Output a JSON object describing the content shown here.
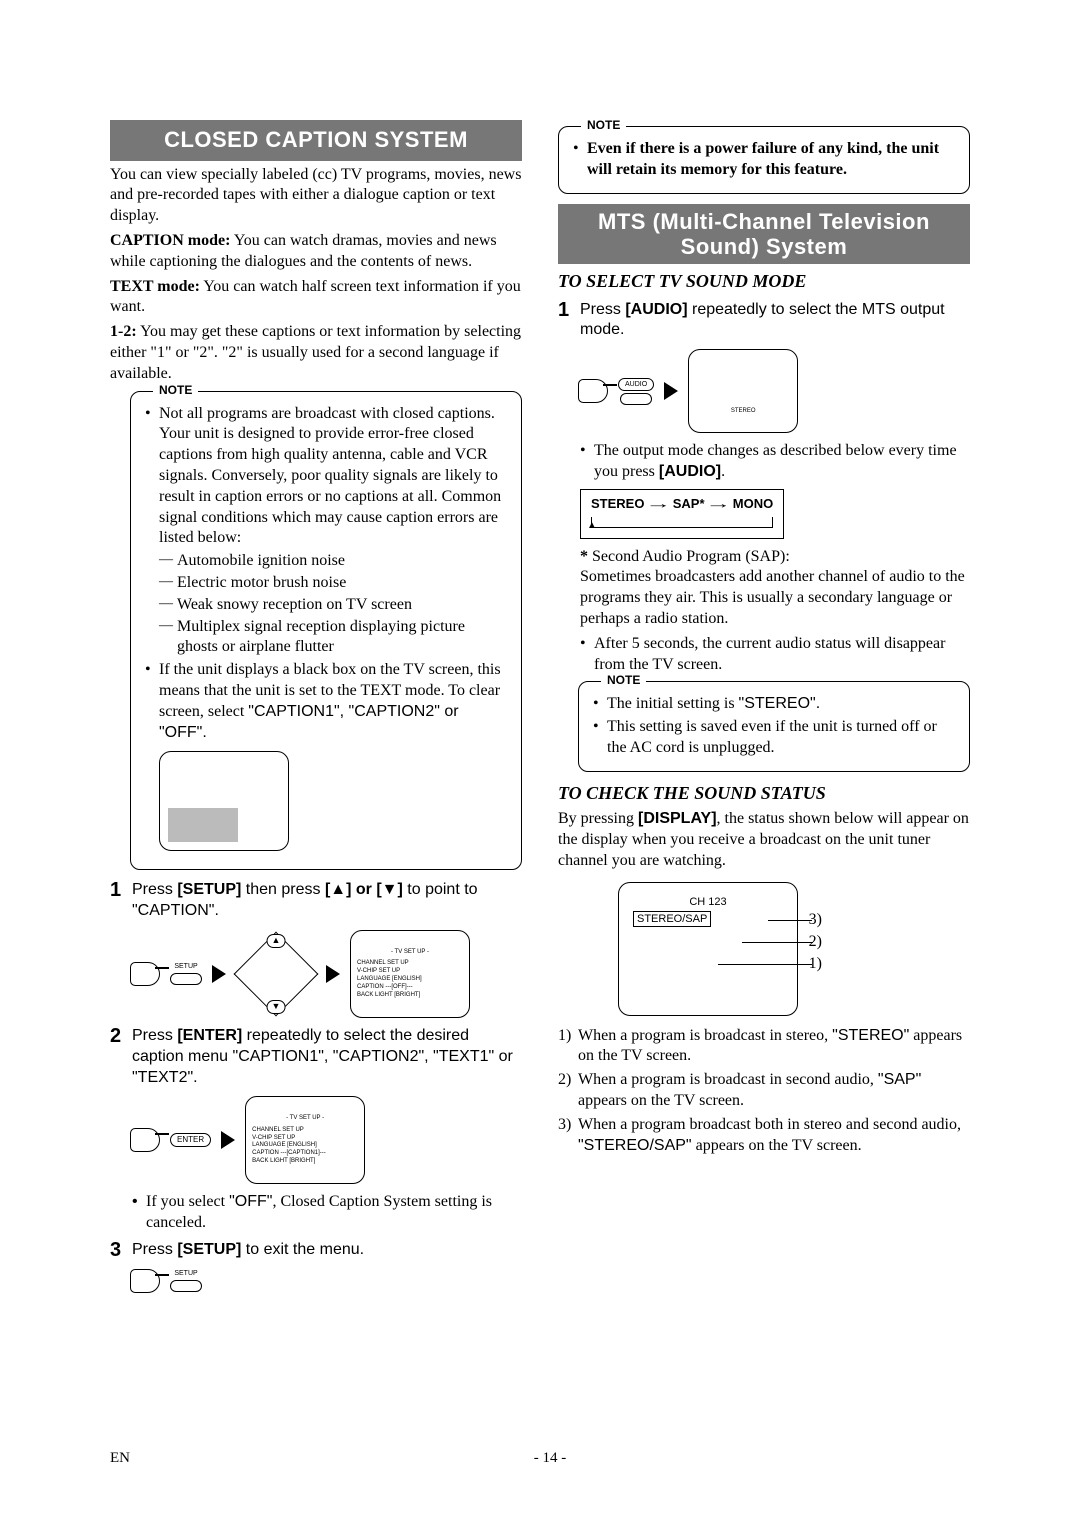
{
  "left": {
    "heading": "CLOSED CAPTION SYSTEM",
    "p1": "You can view specially labeled (cc) TV programs, movies, news and pre-recorded tapes with either a dialogue caption or text display.",
    "caption_mode_label": "CAPTION mode:",
    "caption_mode_text": " You can watch dramas, movies and news while captioning the dialogues and the contents of news.",
    "text_mode_label": "TEXT mode:",
    "text_mode_text": " You can watch half screen text information if you want.",
    "onetwo_label": "1-2:",
    "onetwo_text": " You may get these captions or text information by selecting either \"1\" or \"2\". \"2\" is usually used for a second language if available.",
    "note1": {
      "label": "NOTE",
      "b1": "Not all programs are broadcast with closed captions. Your unit is designed to provide error-free closed captions from high quality antenna, cable and VCR signals. Conversely, poor quality signals are likely to result in caption errors or no captions at all. Common signal conditions which may cause caption errors are listed below:",
      "d1": "Automobile ignition noise",
      "d2": "Electric motor brush noise",
      "d3": "Weak snowy reception on TV screen",
      "d4": "Multiplex signal reception displaying picture ghosts or airplane flutter",
      "b2_pre": "If the unit displays a black box on the TV screen, this means that the unit is set to the TEXT mode. To clear screen, select ",
      "b2_opts": "\"CAPTION1\", \"CAPTION2\" or \"OFF\"."
    },
    "step1": {
      "num": "1",
      "pre": "Press ",
      "setup": "[SETUP]",
      "mid": " then press ",
      "keys": "[▲] or [▼]",
      "post_a": " to point to ",
      "caption_q": "\"CAPTION\".",
      "remote": {
        "setup_label": "SETUP",
        "up": "▲",
        "down": "▼"
      },
      "tv": {
        "title": "- TV SET UP -",
        "l1": "CHANNEL SET UP",
        "l2": "V-CHIP SET UP",
        "l3": "LANGUAGE    [ENGLISH]",
        "l4": "CAPTION   ---[OFF]---",
        "l5": "BACK LIGHT [BRIGHT]"
      }
    },
    "step2": {
      "num": "2",
      "pre": "Press ",
      "enter": "[ENTER]",
      "mid": " repeatedly to select the desired caption menu ",
      "opts": "\"CAPTION1\", \"CAPTION2\", \"TEXT1\" or \"TEXT2\".",
      "remote": {
        "enter_label": "ENTER"
      },
      "tv": {
        "title": "- TV SET UP -",
        "l1": "CHANNEL SET UP",
        "l2": "V-CHIP SET UP",
        "l3": "LANGUAGE    [ENGLISH]",
        "l4": "CAPTION   ---[CAPTION1]---",
        "l5": "BACK LIGHT [BRIGHT]"
      },
      "note_pre": "If you select ",
      "note_off": "\"OFF\"",
      "note_post": ", Closed Caption System setting is canceled."
    },
    "step3": {
      "num": "3",
      "pre": "Press ",
      "setup": "[SETUP]",
      "post": " to exit the menu.",
      "remote": {
        "setup_label": "SETUP"
      }
    }
  },
  "right": {
    "noteTop": {
      "label": "NOTE",
      "text": "Even if there is a power failure of any kind, the unit will retain its memory for this feature."
    },
    "heading": "MTS (Multi-Channel Television Sound) System",
    "sub1": "TO SELECT TV SOUND MODE",
    "step1": {
      "num": "1",
      "pre": "Press ",
      "audio": "[AUDIO]",
      "post": " repeatedly to select the MTS output mode.",
      "remote": {
        "audio_label": "AUDIO"
      },
      "tv_text": "STEREO"
    },
    "cycle_pre": "The output mode changes as described below every time you press ",
    "cycle_key": "[AUDIO]",
    "cycle": {
      "a": "STEREO",
      "b": "SAP*",
      "c": "MONO"
    },
    "sap_label": "*",
    "sap_name": " Second Audio Program (SAP):",
    "sap_text": "Sometimes broadcasters add another channel of audio to the programs they air. This is usually a secondary language or perhaps a radio station.",
    "after5": "After 5 seconds, the current audio status will disappear from the TV screen.",
    "note2": {
      "label": "NOTE",
      "b1_pre": "The initial setting is ",
      "b1_val": "\"STEREO\".",
      "b2": "This setting is saved even if the unit is turned off or the AC cord is unplugged."
    },
    "sub2": "TO CHECK THE SOUND STATUS",
    "check_pre": "By pressing ",
    "check_key": "[DISPLAY]",
    "check_post": ", the status shown below will appear on the display when you receive a broadcast on the unit tuner channel you are watching.",
    "status_tv": {
      "ch": "CH 123",
      "val": "STEREO/SAP",
      "m1": "3)",
      "m2": "2)",
      "m3": "1)"
    },
    "list": {
      "i1_pre": "When a program is broadcast in stereo, ",
      "i1_val": "\"STEREO\"",
      "i1_post": " appears on the TV screen.",
      "i2_pre": "When a program is broadcast in second audio, ",
      "i2_val": "\"SAP\"",
      "i2_post": " appears on the TV screen.",
      "i3_pre": "When a program broadcast both in stereo and second audio, ",
      "i3_val": "\"STEREO/SAP\"",
      "i3_post": " appears on the TV screen."
    }
  },
  "footer": {
    "left": "EN",
    "center": "- 14 -"
  }
}
